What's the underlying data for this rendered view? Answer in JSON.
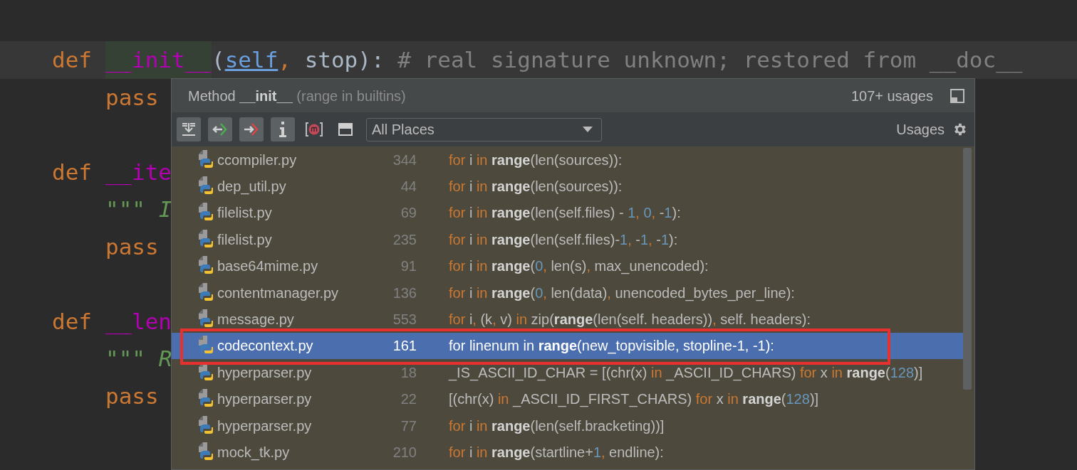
{
  "editor": {
    "blocks": [
      {
        "current": true,
        "tokens": [
          {
            "kw": "def "
          },
          {
            "usage": "__init__"
          },
          {
            "plain": "("
          },
          {
            "param": "self"
          },
          {
            "comma": ","
          },
          {
            "plain": " stop): "
          },
          {
            "comment": "# real signature unknown; restored from __doc__"
          }
        ],
        "children": [
          {
            "current": false,
            "tokens": [
              {
                "kw": "pass"
              }
            ]
          }
        ]
      },
      {
        "current": false,
        "tokens": [
          {
            "kw": "def "
          },
          {
            "magic": "__ite"
          }
        ],
        "children": [
          {
            "current": false,
            "tokens": [
              {
                "doc": "\"\"\" I"
              }
            ]
          },
          {
            "current": false,
            "tokens": [
              {
                "kw": "pass"
              }
            ]
          }
        ]
      },
      {
        "current": false,
        "tokens": [
          {
            "kw": "def "
          },
          {
            "magic": "__len"
          }
        ],
        "children": [
          {
            "current": false,
            "tokens": [
              {
                "doc": "\"\"\" R"
              }
            ]
          },
          {
            "current": false,
            "tokens": [
              {
                "kw": "pass"
              }
            ]
          }
        ]
      }
    ]
  },
  "popup": {
    "title": {
      "prefix": "Method",
      "name": "__init__",
      "scope": "(range in builtins)"
    },
    "usage_count": "107+ usages",
    "toolbar": [
      {
        "kind": "expand",
        "pressed": true
      },
      {
        "kind": "read",
        "pressed": true
      },
      {
        "kind": "write",
        "pressed": true
      },
      {
        "kind": "info",
        "pressed": true
      },
      {
        "kind": "method",
        "pressed": false
      },
      {
        "kind": "preview",
        "pressed": false
      }
    ],
    "scope_dropdown": {
      "value": "All Places"
    },
    "settings_label": "Usages",
    "results": [
      {
        "file": "ccompiler.py",
        "line": "344",
        "selected": false,
        "outlined": false,
        "code": [
          {
            "kw": "for"
          },
          {
            "plain": " i "
          },
          {
            "kw": "in "
          },
          {
            "bold": "range"
          },
          {
            "plain": "(len(sources)):"
          }
        ]
      },
      {
        "file": "dep_util.py",
        "line": "44",
        "selected": false,
        "outlined": false,
        "code": [
          {
            "kw": "for"
          },
          {
            "plain": " i "
          },
          {
            "kw": "in "
          },
          {
            "bold": "range"
          },
          {
            "plain": "(len(sources)):"
          }
        ]
      },
      {
        "file": "filelist.py",
        "line": "69",
        "selected": false,
        "outlined": false,
        "code": [
          {
            "kw": "for"
          },
          {
            "plain": " i "
          },
          {
            "kw": "in "
          },
          {
            "bold": "range"
          },
          {
            "plain": "(len(self.files) - "
          },
          {
            "num": "1"
          },
          {
            "kw": ", "
          },
          {
            "num": "0"
          },
          {
            "kw": ","
          },
          {
            "plain": " -"
          },
          {
            "num": "1"
          },
          {
            "plain": "):"
          }
        ]
      },
      {
        "file": "filelist.py",
        "line": "235",
        "selected": false,
        "outlined": false,
        "code": [
          {
            "kw": "for"
          },
          {
            "plain": " i "
          },
          {
            "kw": "in "
          },
          {
            "bold": "range"
          },
          {
            "plain": "(len(self.files)-"
          },
          {
            "num": "1"
          },
          {
            "kw": ","
          },
          {
            "plain": " -"
          },
          {
            "num": "1"
          },
          {
            "kw": ","
          },
          {
            "plain": " -"
          },
          {
            "num": "1"
          },
          {
            "plain": "):"
          }
        ]
      },
      {
        "file": "base64mime.py",
        "line": "91",
        "selected": false,
        "outlined": false,
        "code": [
          {
            "kw": "for"
          },
          {
            "plain": " i "
          },
          {
            "kw": "in "
          },
          {
            "bold": "range"
          },
          {
            "plain": "("
          },
          {
            "num": "0"
          },
          {
            "kw": ","
          },
          {
            "plain": " len(s)"
          },
          {
            "kw": ","
          },
          {
            "plain": " max_unencoded):"
          }
        ]
      },
      {
        "file": "contentmanager.py",
        "line": "136",
        "selected": false,
        "outlined": false,
        "code": [
          {
            "kw": "for"
          },
          {
            "plain": " i "
          },
          {
            "kw": "in "
          },
          {
            "bold": "range"
          },
          {
            "plain": "("
          },
          {
            "num": "0"
          },
          {
            "kw": ","
          },
          {
            "plain": " len(data)"
          },
          {
            "kw": ","
          },
          {
            "plain": " unencoded_bytes_per_line):"
          }
        ]
      },
      {
        "file": "message.py",
        "line": "553",
        "selected": false,
        "outlined": false,
        "code": [
          {
            "kw": "for"
          },
          {
            "plain": " i"
          },
          {
            "kw": ","
          },
          {
            "plain": " (k"
          },
          {
            "kw": ","
          },
          {
            "plain": " v) "
          },
          {
            "kw": "in"
          },
          {
            "plain": " zip("
          },
          {
            "bold": "range"
          },
          {
            "plain": "(len(self. headers))"
          },
          {
            "kw": ","
          },
          {
            "plain": " self. headers):"
          }
        ]
      },
      {
        "file": "codecontext.py",
        "line": "161",
        "selected": true,
        "outlined": true,
        "code": [
          {
            "kw": "for"
          },
          {
            "plain": " linenum "
          },
          {
            "kw": "in "
          },
          {
            "bold": "range"
          },
          {
            "plain": "(new_topvisible, stopline-"
          },
          {
            "num": "1"
          },
          {
            "kw": ","
          },
          {
            "plain": " -"
          },
          {
            "num": "1"
          },
          {
            "plain": "):"
          }
        ]
      },
      {
        "file": "hyperparser.py",
        "line": "18",
        "selected": false,
        "outlined": false,
        "code": [
          {
            "plain": "_IS_ASCII_ID_CHAR = [(chr(x) "
          },
          {
            "kw": "in"
          },
          {
            "plain": " _ASCII_ID_CHARS) "
          },
          {
            "kw": "for"
          },
          {
            "plain": " x "
          },
          {
            "kw": "in "
          },
          {
            "bold": "range"
          },
          {
            "plain": "("
          },
          {
            "num": "128"
          },
          {
            "plain": ")]"
          }
        ]
      },
      {
        "file": "hyperparser.py",
        "line": "22",
        "selected": false,
        "outlined": false,
        "code": [
          {
            "plain": "[(chr(x) "
          },
          {
            "kw": "in"
          },
          {
            "plain": " _ASCII_ID_FIRST_CHARS) "
          },
          {
            "kw": "for"
          },
          {
            "plain": " x "
          },
          {
            "kw": "in "
          },
          {
            "bold": "range"
          },
          {
            "plain": "("
          },
          {
            "num": "128"
          },
          {
            "plain": ")]"
          }
        ]
      },
      {
        "file": "hyperparser.py",
        "line": "77",
        "selected": false,
        "outlined": false,
        "code": [
          {
            "kw": "for"
          },
          {
            "plain": " i "
          },
          {
            "kw": "in "
          },
          {
            "bold": "range"
          },
          {
            "plain": "(len(self.bracketing))]"
          }
        ]
      },
      {
        "file": "mock_tk.py",
        "line": "210",
        "selected": false,
        "outlined": false,
        "code": [
          {
            "kw": "for"
          },
          {
            "plain": " i "
          },
          {
            "kw": "in "
          },
          {
            "bold": "range"
          },
          {
            "plain": "(startline+"
          },
          {
            "num": "1"
          },
          {
            "kw": ","
          },
          {
            "plain": " endline):"
          }
        ]
      }
    ]
  }
}
